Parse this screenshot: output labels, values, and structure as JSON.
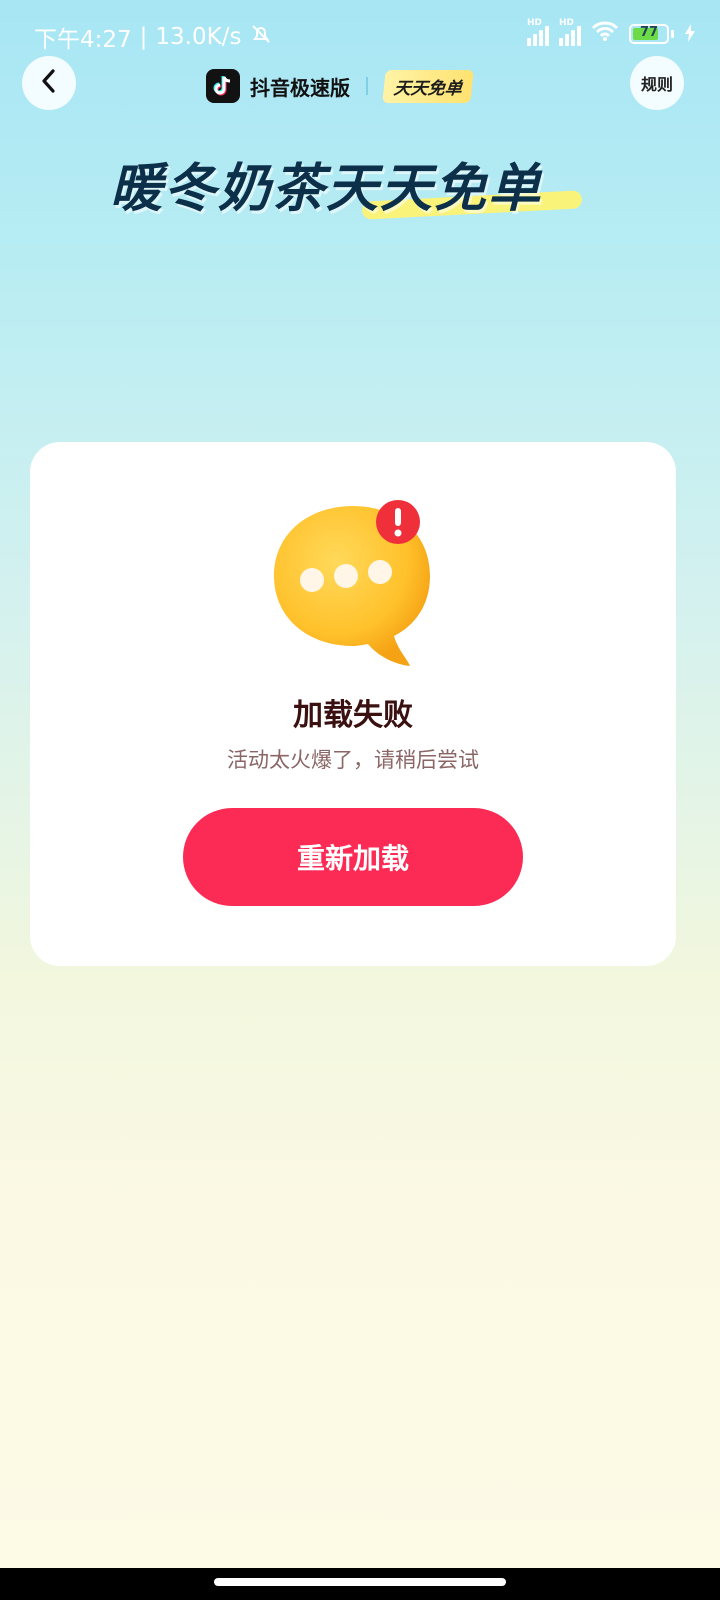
{
  "status_bar": {
    "time": "下午4:27",
    "separator": "|",
    "net_speed": "13.0K/s",
    "battery_level": "77"
  },
  "header": {
    "brand_name": "抖音极速版",
    "brand_badge": "天天免单",
    "rules_label": "规则"
  },
  "hero": {
    "title": "暖冬奶茶天天免单"
  },
  "error_card": {
    "title": "加载失败",
    "subtitle": "活动太火爆了，请稍后尝试",
    "reload_label": "重新加载"
  },
  "colors": {
    "accent": "#fc2b55",
    "title_text": "#3a1010",
    "subtitle_text": "#8a6666"
  },
  "icons": {
    "back": "chevron-left-icon",
    "error": "chat-bubble-error-icon",
    "silent": "bell-off-icon",
    "wifi": "wifi-icon",
    "charging": "lightning-icon"
  }
}
